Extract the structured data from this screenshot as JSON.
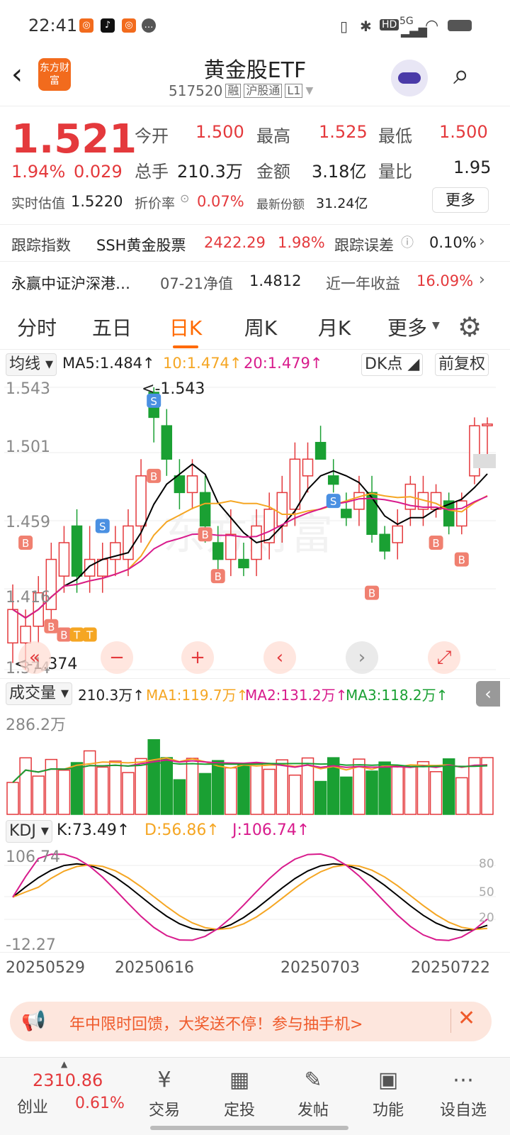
{
  "status_bar": {
    "time": "22:41",
    "right_text": "5G"
  },
  "header": {
    "back_icon": "chevron-left-icon",
    "logo_text": "东方财富",
    "title": "黄金股ETF",
    "code": "517520",
    "badge_rong": "融",
    "badge_hgt": "沪股通",
    "badge_level": "L1"
  },
  "quote": {
    "price": "1.521",
    "change_pct": "1.94%",
    "change_abs": "0.029",
    "open_label": "今开",
    "open": "1.500",
    "high_label": "最高",
    "high": "1.525",
    "low_label": "最低",
    "low": "1.500",
    "vol_label": "总手",
    "vol": "210.3万",
    "amt_label": "金额",
    "amt": "3.18亿",
    "ratio_label": "量比",
    "ratio": "1.95",
    "est_label": "实时估值",
    "est": "1.5220",
    "premium_label": "折价率",
    "premium": "0.07%",
    "shares_label": "最新份额",
    "shares": "31.24亿",
    "more": "更多"
  },
  "tracking": {
    "label": "跟踪指数",
    "index_name": "SSH黄金股票",
    "index_val": "2422.29",
    "index_pct": "1.98%",
    "err_label": "跟踪误差",
    "err": "0.10%"
  },
  "fund": {
    "name": "永赢中证沪深港…",
    "nav_label": "07-21净值",
    "nav": "1.4812",
    "ret_label": "近一年收益",
    "ret": "16.09%"
  },
  "tabs": [
    "分时",
    "五日",
    "日K",
    "周K",
    "月K",
    "更多"
  ],
  "active_tab": "日K",
  "ma_bar": {
    "selector": "均线",
    "ma5": "MA5:1.484",
    "ma10": "10:1.474",
    "ma20": "20:1.479",
    "dk": "DK点",
    "fq": "前复权"
  },
  "kchart": {
    "y_labels": [
      "1.543",
      "1.501",
      "1.459",
      "1.416",
      "1.374"
    ],
    "max_label": "-1.543",
    "min_label": "-1.374",
    "colors": {
      "up": "#e4393c",
      "down": "#1aa033",
      "ma5": "#000000",
      "ma10": "#f5a623",
      "ma20": "#d81b8c"
    }
  },
  "vol_bar": {
    "selector": "成交量",
    "vol": "210.3万",
    "ma1": "MA1:119.7万",
    "ma2": "MA2:131.2万",
    "ma3": "MA3:118.2万",
    "y_label": "286.2万"
  },
  "kdj_bar": {
    "selector": "KDJ",
    "k": "K:73.49",
    "d": "D:56.86",
    "j": "J:106.74",
    "y_top": "106.74",
    "y_bottom": "-12.27",
    "ref_80": "80",
    "ref_50": "50",
    "ref_20": "20"
  },
  "dates": [
    "20250529",
    "20250616",
    "20250703",
    "20250722"
  ],
  "banner": {
    "text": "年中限时回馈，大奖送不停！参与抽手机>"
  },
  "bottom_nav": {
    "index_val": "2310.86",
    "index_name": "创业",
    "index_pct": "0.61%",
    "items": [
      "交易",
      "定投",
      "发帖",
      "功能",
      "设自选"
    ]
  }
}
